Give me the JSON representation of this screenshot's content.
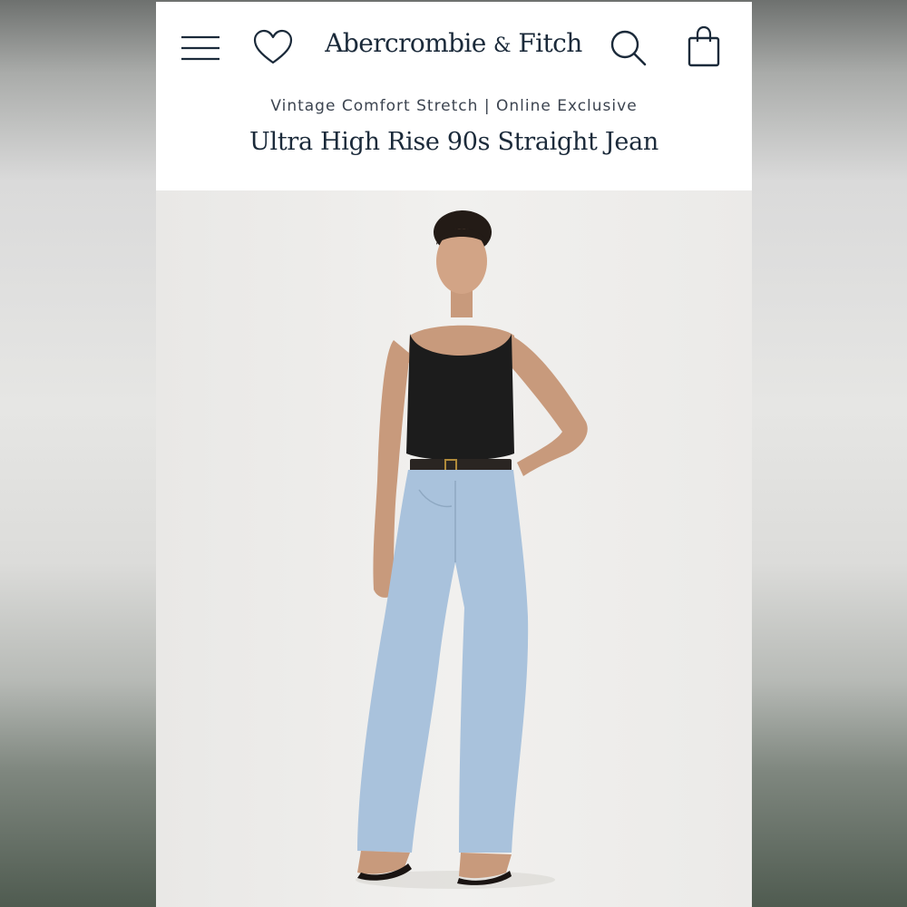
{
  "header": {
    "brand_name": "Abercrombie",
    "brand_amp": "&",
    "brand_name2": "Fitch",
    "icons": {
      "menu": "hamburger-menu-icon",
      "wishlist": "heart-icon",
      "search": "search-icon",
      "bag": "shopping-bag-icon"
    }
  },
  "product": {
    "collection_label": "Vintage Comfort Stretch | Online Exclusive",
    "title": "Ultra High Rise 90s Straight Jean"
  },
  "colors": {
    "brand_navy": "#1b2a3a",
    "denim": "#a9c2dc",
    "bodysuit": "#1c1c1c"
  }
}
